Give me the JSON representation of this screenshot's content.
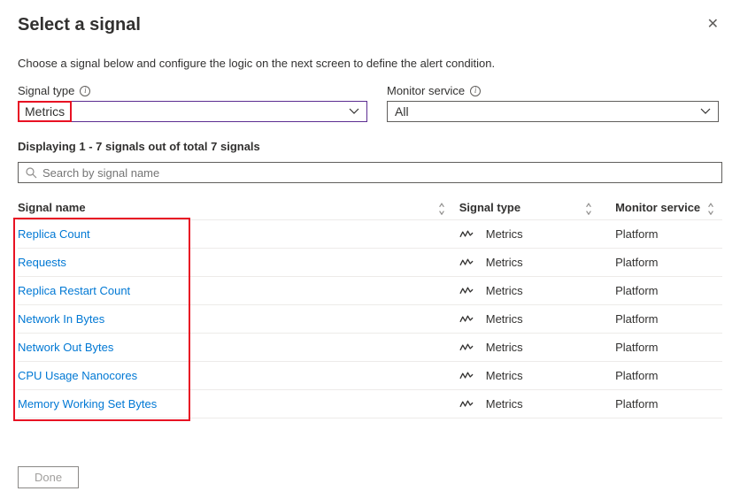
{
  "title": "Select a signal",
  "description": "Choose a signal below and configure the logic on the next screen to define the alert condition.",
  "filters": {
    "signal_type": {
      "label": "Signal type",
      "value": "Metrics"
    },
    "monitor_service": {
      "label": "Monitor service",
      "value": "All"
    }
  },
  "countLine": "Displaying 1 - 7 signals out of total 7 signals",
  "search": {
    "placeholder": "Search by signal name"
  },
  "columns": {
    "name": "Signal name",
    "type": "Signal type",
    "service": "Monitor service"
  },
  "rows": [
    {
      "name": "Replica Count",
      "type": "Metrics",
      "service": "Platform"
    },
    {
      "name": "Requests",
      "type": "Metrics",
      "service": "Platform"
    },
    {
      "name": "Replica Restart Count",
      "type": "Metrics",
      "service": "Platform"
    },
    {
      "name": "Network In Bytes",
      "type": "Metrics",
      "service": "Platform"
    },
    {
      "name": "Network Out Bytes",
      "type": "Metrics",
      "service": "Platform"
    },
    {
      "name": "CPU Usage Nanocores",
      "type": "Metrics",
      "service": "Platform"
    },
    {
      "name": "Memory Working Set Bytes",
      "type": "Metrics",
      "service": "Platform"
    }
  ],
  "doneLabel": "Done"
}
